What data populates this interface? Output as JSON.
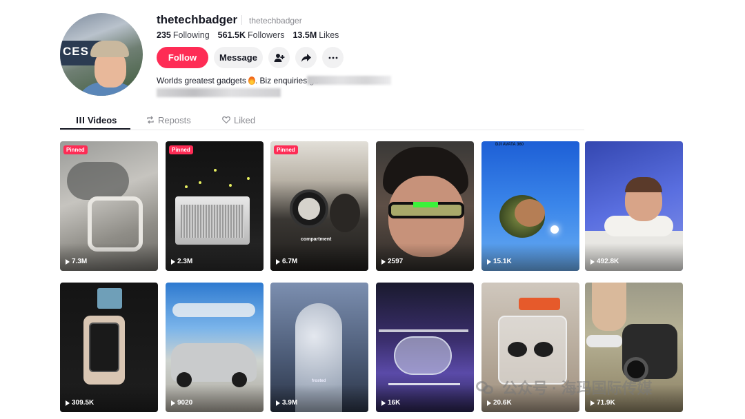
{
  "profile": {
    "username": "thetechbadger",
    "nickname": "thetechbadger",
    "stats": [
      {
        "value": "235",
        "label": "Following"
      },
      {
        "value": "561.5K",
        "label": "Followers"
      },
      {
        "value": "13.5M",
        "label": "Likes"
      }
    ],
    "follow_label": "Follow",
    "message_label": "Message",
    "bio": "Worlds greatest gadgets",
    "bio_tail": ". Biz enquiries gu",
    "avatar_sign": "CES"
  },
  "tabs": [
    {
      "label": "Videos",
      "icon": "grid-icon",
      "active": true
    },
    {
      "label": "Reposts",
      "icon": "repost-icon",
      "active": false
    },
    {
      "label": "Liked",
      "icon": "heart-icon",
      "active": false
    }
  ],
  "pinned_label": "Pinned",
  "videos": [
    {
      "views": "7.3M",
      "pinned": true,
      "caption": ""
    },
    {
      "views": "2.3M",
      "pinned": true,
      "caption": ""
    },
    {
      "views": "6.7M",
      "pinned": true,
      "caption": "compartment"
    },
    {
      "views": "2597",
      "pinned": false,
      "caption": ""
    },
    {
      "views": "15.1K",
      "pinned": false,
      "caption": "DJI AVATA 360"
    },
    {
      "views": "492.8K",
      "pinned": false,
      "caption": ""
    },
    {
      "views": "309.5K",
      "pinned": false,
      "caption": ""
    },
    {
      "views": "9020",
      "pinned": false,
      "caption": ""
    },
    {
      "views": "3.9M",
      "pinned": false,
      "caption": "frosted"
    },
    {
      "views": "16K",
      "pinned": false,
      "caption": ""
    },
    {
      "views": "20.6K",
      "pinned": false,
      "caption": ""
    },
    {
      "views": "71.9K",
      "pinned": false,
      "caption": ""
    }
  ],
  "watermark": "公众号 · 海玛国际传媒",
  "colors": {
    "accent": "#fe2c55",
    "text": "#161823",
    "muted": "#8a8b91"
  }
}
